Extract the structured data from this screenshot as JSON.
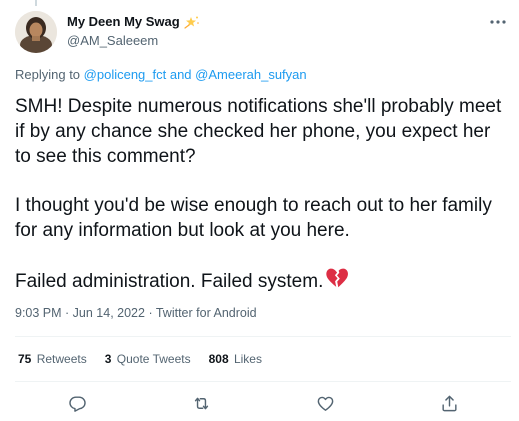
{
  "author": {
    "display_name": "My Deen My Swag",
    "handle": "@AM_Saleeem",
    "badge_icon": "sparkle-star-icon"
  },
  "reply_context": {
    "prefix": "Replying to ",
    "mention_1": "@policeng_fct",
    "conjunction": " and ",
    "mention_2": "@Ameerah_sufyan"
  },
  "tweet": {
    "paragraph_1": "SMH! Despite numerous notifications she'll probably meet if by any chance she checked her phone, you expect her to see this comment?",
    "paragraph_2": "I thought you'd be wise enough to reach out to her family for any information but look at you here.",
    "paragraph_3": "Failed administration. Failed system.",
    "trailing_emoji": "broken-heart-icon"
  },
  "meta": {
    "time": "9:03 PM",
    "separator": " · ",
    "date": "Jun 14, 2022",
    "source": "Twitter for Android"
  },
  "stats": {
    "retweets_count": "75",
    "retweets_label": "Retweets",
    "quotes_count": "3",
    "quotes_label": "Quote Tweets",
    "likes_count": "808",
    "likes_label": "Likes"
  },
  "actions": [
    "reply-icon",
    "retweet-icon",
    "like-icon",
    "share-icon"
  ],
  "colors": {
    "link": "#1d9bf0",
    "secondary_text": "#536471",
    "primary_text": "#0f1419",
    "divider": "#eff3f4",
    "broken_heart": "#e0245e"
  }
}
